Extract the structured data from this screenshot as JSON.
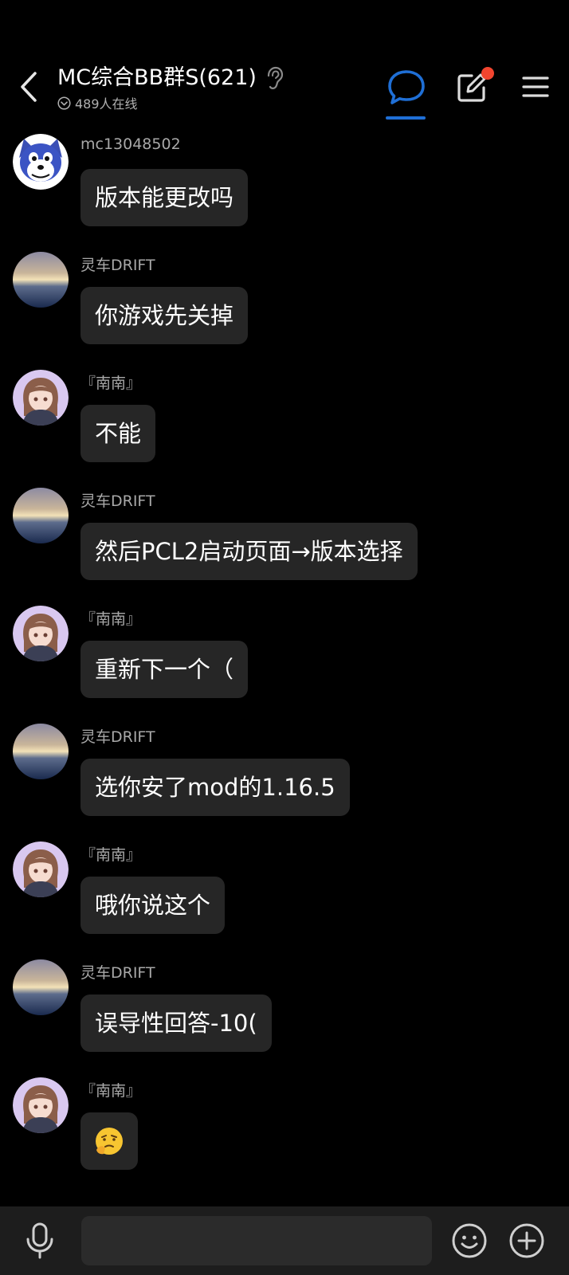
{
  "header": {
    "title": "MC综合BB群S(621)",
    "online_text": "489人在线",
    "accent_color": "#1f6fd6",
    "notification_dot_color": "#f2452f"
  },
  "messages": [
    {
      "sender": "mc13048502",
      "text": "版本能更改吗",
      "avatar": "blue-dog-avatar"
    },
    {
      "sender": "灵车DRIFT",
      "text": "你游戏先关掉",
      "avatar": "sunset-sky-avatar"
    },
    {
      "sender": "『南南』",
      "text": "不能",
      "avatar": "anime-girl-avatar"
    },
    {
      "sender": "灵车DRIFT",
      "text": "然后PCL2启动页面→版本选择",
      "avatar": "sunset-sky-avatar"
    },
    {
      "sender": "『南南』",
      "text": "重新下一个（",
      "avatar": "anime-girl-avatar"
    },
    {
      "sender": "灵车DRIFT",
      "text": "选你安了mod的1.16.5",
      "avatar": "sunset-sky-avatar"
    },
    {
      "sender": "『南南』",
      "text": "哦你说这个",
      "avatar": "anime-girl-avatar"
    },
    {
      "sender": "灵车DRIFT",
      "text": "误导性回答-10(",
      "avatar": "sunset-sky-avatar"
    },
    {
      "sender": "『南南』",
      "text": "",
      "emoji": "thinking-face-emoji",
      "avatar": "anime-girl-avatar"
    }
  ],
  "input": {
    "value": "",
    "placeholder": ""
  },
  "icons": {
    "back": "back-arrow-icon",
    "ear": "ear-icon",
    "online": "chevron-circle-icon",
    "chat": "chat-bubble-icon",
    "edit": "edit-icon",
    "menu": "menu-icon",
    "mic": "microphone-icon",
    "emoji": "smiley-icon",
    "plus": "plus-circle-icon"
  }
}
